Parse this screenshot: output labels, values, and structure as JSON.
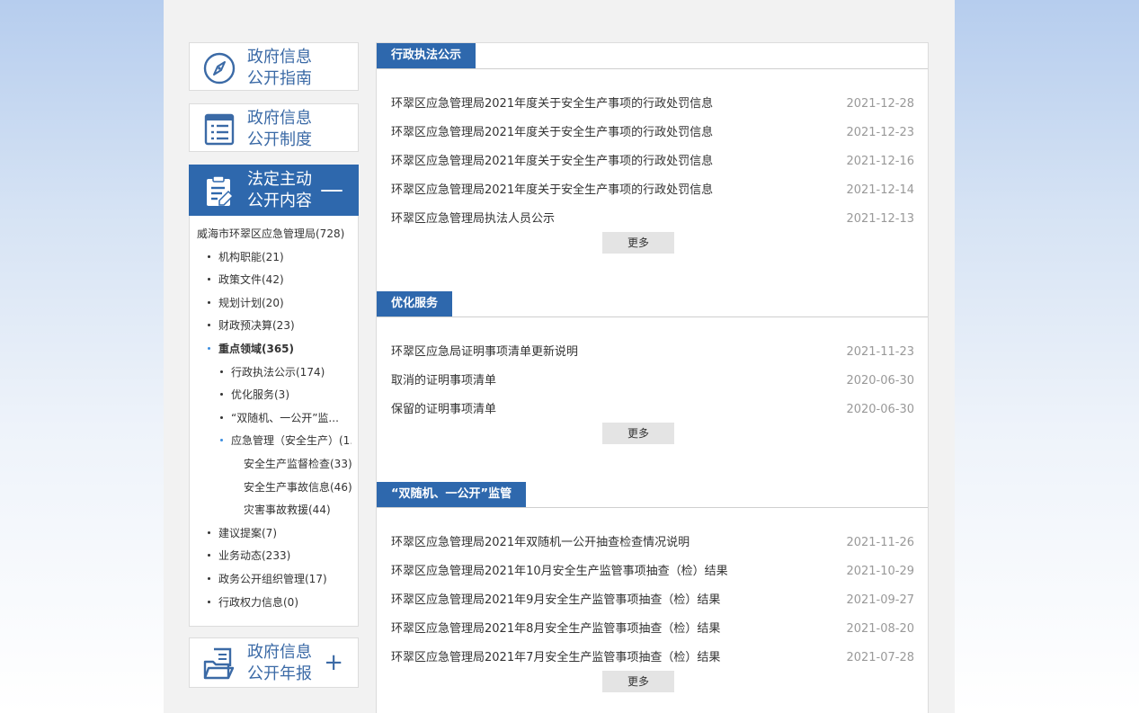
{
  "sidebar": {
    "guide": {
      "line1": "政府信息",
      "line2": "公开指南"
    },
    "system": {
      "line1": "政府信息",
      "line2": "公开制度"
    },
    "statutory": {
      "line1": "法定主动",
      "line2": "公开内容",
      "toggle": "—"
    },
    "annual": {
      "line1": "政府信息",
      "line2": "公开年报",
      "toggle": "+"
    },
    "tree": [
      {
        "label": "威海市环翠区应急管理局(728)",
        "level": 0
      },
      {
        "label": "机构职能(21)",
        "level": 1
      },
      {
        "label": "政策文件(42)",
        "level": 1
      },
      {
        "label": "规划计划(20)",
        "level": 1
      },
      {
        "label": "财政预决算(23)",
        "level": 1
      },
      {
        "label": "重点领域(365)",
        "level": 1,
        "highlight": true,
        "bold": true
      },
      {
        "label": "行政执法公示(174)",
        "level": 2
      },
      {
        "label": "优化服务(3)",
        "level": 2
      },
      {
        "label": "“双随机、一公开”监...",
        "level": 2
      },
      {
        "label": "应急管理（安全生产）(1...",
        "level": 2,
        "highlight": true
      },
      {
        "label": "安全生产监督检查(33)",
        "level": 3
      },
      {
        "label": "安全生产事故信息(46)",
        "level": 3
      },
      {
        "label": "灾害事故救援(44)",
        "level": 3
      },
      {
        "label": "建议提案(7)",
        "level": 1
      },
      {
        "label": "业务动态(233)",
        "level": 1
      },
      {
        "label": "政务公开组织管理(17)",
        "level": 1
      },
      {
        "label": "行政权力信息(0)",
        "level": 1
      }
    ]
  },
  "sections": [
    {
      "title": "行政执法公示",
      "more": "更多",
      "items": [
        {
          "title": "环翠区应急管理局2021年度关于安全生产事项的行政处罚信息",
          "date": "2021-12-28"
        },
        {
          "title": "环翠区应急管理局2021年度关于安全生产事项的行政处罚信息",
          "date": "2021-12-23"
        },
        {
          "title": "环翠区应急管理局2021年度关于安全生产事项的行政处罚信息",
          "date": "2021-12-16"
        },
        {
          "title": "环翠区应急管理局2021年度关于安全生产事项的行政处罚信息",
          "date": "2021-12-14"
        },
        {
          "title": "环翠区应急管理局执法人员公示",
          "date": "2021-12-13"
        }
      ]
    },
    {
      "title": "优化服务",
      "more": "更多",
      "items": [
        {
          "title": "环翠区应急局证明事项清单更新说明",
          "date": "2021-11-23"
        },
        {
          "title": "取消的证明事项清单",
          "date": "2020-06-30"
        },
        {
          "title": "保留的证明事项清单",
          "date": "2020-06-30"
        }
      ]
    },
    {
      "title": "“双随机、一公开”监管",
      "more": "更多",
      "items": [
        {
          "title": "环翠区应急管理局2021年双随机一公开抽查检查情况说明",
          "date": "2021-11-26"
        },
        {
          "title": "环翠区应急管理局2021年10月安全生产监管事项抽查（检）结果",
          "date": "2021-10-29"
        },
        {
          "title": "环翠区应急管理局2021年9月安全生产监管事项抽查（检）结果",
          "date": "2021-09-27"
        },
        {
          "title": "环翠区应急管理局2021年8月安全生产监管事项抽查（检）结果",
          "date": "2021-08-20"
        },
        {
          "title": "环翠区应急管理局2021年7月安全生产监管事项抽查（检）结果",
          "date": "2021-07-28"
        }
      ]
    }
  ],
  "colors": {
    "accent": "#2e68ad",
    "text": "#333333",
    "date": "#999999"
  },
  "icons": {
    "guide": "compass-icon",
    "system": "list-document-icon",
    "statutory": "clipboard-edit-icon",
    "annual": "report-folder-icon"
  }
}
